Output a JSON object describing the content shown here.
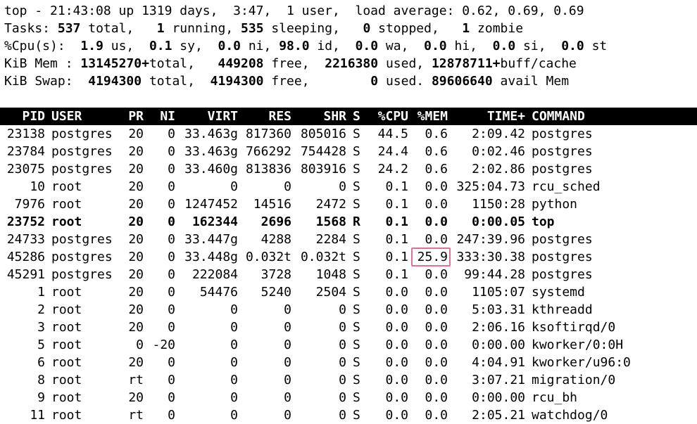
{
  "summary": {
    "line1": "top - 21:43:08 up 1319 days,  3:47,  1 user,  load average: 0.62, 0.69, 0.69",
    "tasks": {
      "label": "Tasks:",
      "total": "537",
      "total_label": "total,",
      "running": "1",
      "running_label": "running,",
      "sleeping": "535",
      "sleeping_label": "sleeping,",
      "stopped": "0",
      "stopped_label": "stopped,",
      "zombie": "1",
      "zombie_label": "zombie"
    },
    "cpu": {
      "label": "%Cpu(s):",
      "us": "1.9",
      "sy": "0.1",
      "ni": "0.0",
      "id": "98.0",
      "wa": "0.0",
      "hi": "0.0",
      "si": "0.0",
      "st": "0.0"
    },
    "mem": {
      "label": "KiB Mem :",
      "total": "13145270+",
      "total_label": "total,",
      "free": "449208",
      "free_label": "free,",
      "used": "2216380",
      "used_label": "used,",
      "buff": "12878711+",
      "buff_label": "buff/cache"
    },
    "swap": {
      "label": "KiB Swap:",
      "total": "4194300",
      "total_label": "total,",
      "free": "4194300",
      "free_label": "free,",
      "used": "0",
      "used_label": "used.",
      "avail": "89606640",
      "avail_label": "avail Mem"
    }
  },
  "columns": [
    "PID",
    "USER",
    "PR",
    "NI",
    "VIRT",
    "RES",
    "SHR",
    "S",
    "%CPU",
    "%MEM",
    "TIME+",
    "COMMAND"
  ],
  "processes": [
    [
      "23138",
      "postgres",
      "20",
      "0",
      "33.463g",
      "817360",
      "805016",
      "S",
      "44.5",
      "0.6",
      "2:09.42",
      "postgres"
    ],
    [
      "23784",
      "postgres",
      "20",
      "0",
      "33.463g",
      "766292",
      "754428",
      "S",
      "24.4",
      "0.6",
      "0:02.46",
      "postgres"
    ],
    [
      "23075",
      "postgres",
      "20",
      "0",
      "33.460g",
      "813836",
      "803916",
      "S",
      "24.2",
      "0.6",
      "2:02.86",
      "postgres"
    ],
    [
      "10",
      "root",
      "20",
      "0",
      "0",
      "0",
      "0",
      "S",
      "0.1",
      "0.0",
      "325:04.73",
      "rcu_sched"
    ],
    [
      "7976",
      "root",
      "20",
      "0",
      "1247452",
      "14516",
      "2472",
      "S",
      "0.1",
      "0.0",
      "1150:28",
      "python"
    ],
    [
      "23752",
      "root",
      "20",
      "0",
      "162344",
      "2696",
      "1568",
      "R",
      "0.1",
      "0.0",
      "0:00.05",
      "top"
    ],
    [
      "24733",
      "postgres",
      "20",
      "0",
      "33.447g",
      "4288",
      "2284",
      "S",
      "0.1",
      "0.0",
      "247:39.96",
      "postgres"
    ],
    [
      "45286",
      "postgres",
      "20",
      "0",
      "33.448g",
      "0.032t",
      "0.032t",
      "S",
      "0.1",
      "25.9",
      "333:30.38",
      "postgres"
    ],
    [
      "45291",
      "postgres",
      "20",
      "0",
      "222084",
      "3728",
      "1048",
      "S",
      "0.1",
      "0.0",
      "99:44.28",
      "postgres"
    ],
    [
      "1",
      "root",
      "20",
      "0",
      "54476",
      "5240",
      "2504",
      "S",
      "0.0",
      "0.0",
      "1105:07",
      "systemd"
    ],
    [
      "2",
      "root",
      "20",
      "0",
      "0",
      "0",
      "0",
      "S",
      "0.0",
      "0.0",
      "5:03.31",
      "kthreadd"
    ],
    [
      "3",
      "root",
      "20",
      "0",
      "0",
      "0",
      "0",
      "S",
      "0.0",
      "0.0",
      "2:06.16",
      "ksoftirqd/0"
    ],
    [
      "5",
      "root",
      "0",
      "-20",
      "0",
      "0",
      "0",
      "S",
      "0.0",
      "0.0",
      "0:00.00",
      "kworker/0:0H"
    ],
    [
      "6",
      "root",
      "20",
      "0",
      "0",
      "0",
      "0",
      "S",
      "0.0",
      "0.0",
      "4:04.91",
      "kworker/u96:0"
    ],
    [
      "8",
      "root",
      "rt",
      "0",
      "0",
      "0",
      "0",
      "S",
      "0.0",
      "0.0",
      "3:07.21",
      "migration/0"
    ],
    [
      "9",
      "root",
      "20",
      "0",
      "0",
      "0",
      "0",
      "S",
      "0.0",
      "0.0",
      "0:00.00",
      "rcu_bh"
    ],
    [
      "11",
      "root",
      "rt",
      "0",
      "0",
      "0",
      "0",
      "S",
      "0.0",
      "0.0",
      "2:05.21",
      "watchdog/0"
    ]
  ],
  "bold_row_index": 5,
  "highlight": {
    "row_index": 7,
    "column": "%MEM",
    "color": "#e0709a"
  },
  "colors": {
    "background": "#ffffff",
    "text": "#000000",
    "header_bg": "#000000",
    "header_text": "#ffffff"
  }
}
